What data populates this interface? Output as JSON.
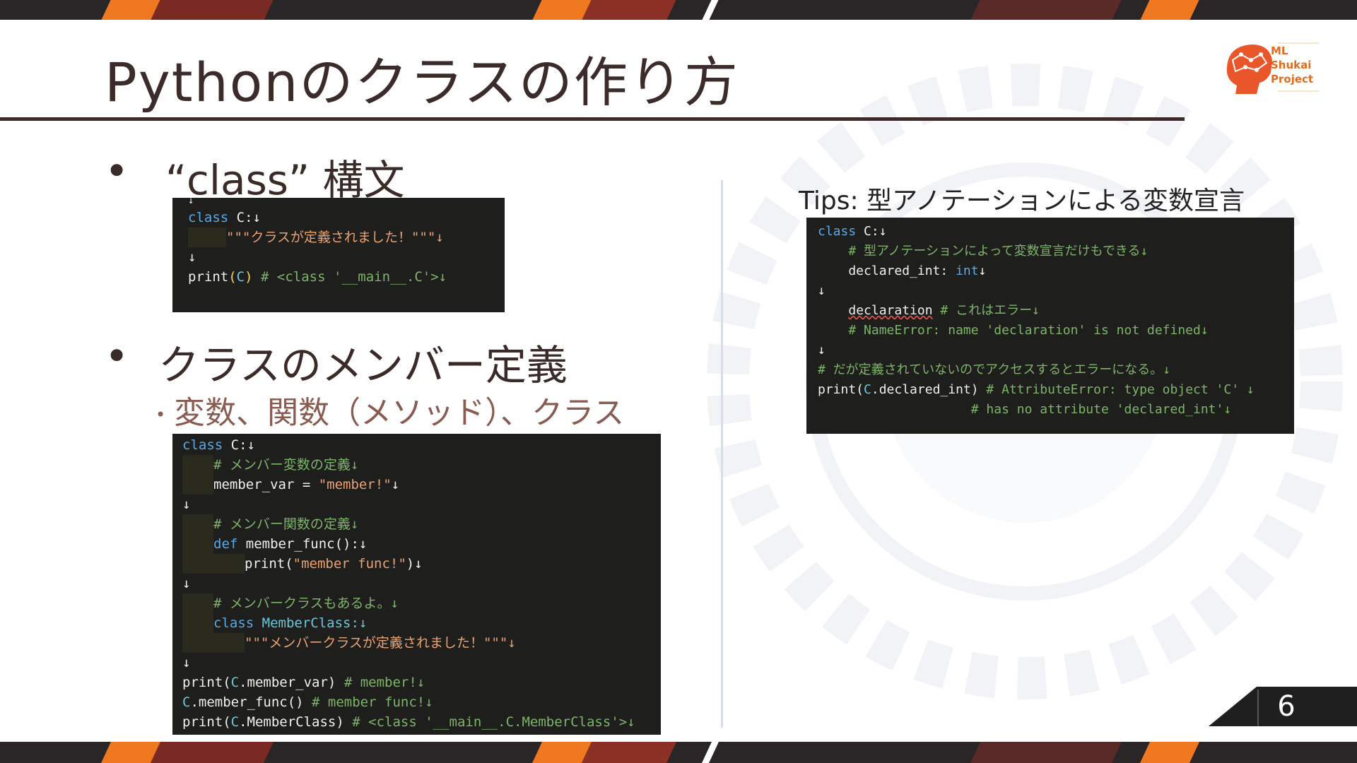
{
  "slide": {
    "title": "Pythonのクラスの作り方",
    "page_number": "6"
  },
  "logo": {
    "line1": "ML",
    "line2": "Shukai",
    "line3": "Project"
  },
  "bullets": {
    "b1": "“class” 構文",
    "b2": "クラスのメンバー定義",
    "b2_sub": "変数、関数（メソッド）、クラス",
    "dot": "•"
  },
  "code1": {
    "l0": "↓",
    "l1_kw": "class",
    "l1_rest": " C:↓",
    "l2": "\"\"\"クラスが定義されました！\"\"\"↓",
    "l3": "↓",
    "l4_fn": "print",
    "l4_arg": "C",
    "l4_cm": " # <class '__main__.C'>↓"
  },
  "code2": {
    "l1_kw": "class",
    "l1_rest": " C:↓",
    "l2": "# メンバー変数の定義↓",
    "l3_a": "member_var = ",
    "l3_b": "\"member!\"",
    "l3_c": "↓",
    "l4": "↓",
    "l5": "# メンバー関数の定義↓",
    "l6_kw": "def",
    "l6_rest": " member_func():↓",
    "l7_fn": "print(",
    "l7_str": "\"member func!\"",
    "l7_end": ")↓",
    "l8": "↓",
    "l9": "# メンバークラスもあるよ。↓",
    "l10_kw": "class",
    "l10_rest": " MemberClass:↓",
    "l11": "\"\"\"メンバークラスが定義されました！\"\"\"↓",
    "l12": "↓",
    "l13_a": "print(",
    "l13_b": "C",
    "l13_c": ".member_var)",
    "l13_cm": " # member!↓",
    "l14_a": "C",
    "l14_b": ".member_func()",
    "l14_cm": " # member func!↓",
    "l15_a": "print(",
    "l15_b": "C",
    "l15_c": ".MemberClass)",
    "l15_cm": " # <class '__main__.C.MemberClass'>↓"
  },
  "tips": {
    "title": "Tips: 型アノテーションによる変数宣言"
  },
  "code3": {
    "l1_kw": "class",
    "l1_rest": " C:↓",
    "l2": "    # 型アノテーションによって変数宣言だけもできる↓",
    "l3_a": "    declared_int: ",
    "l3_b": "int",
    "l3_c": "↓",
    "l4": "↓",
    "l5_a": "declaration",
    "l5_cm": " # これはエラー↓",
    "l6": "    # NameError: name 'declaration' is not defined↓",
    "l7": "↓",
    "l8": "# だが定義されていないのでアクセスするとエラーになる。↓",
    "l9_a": "print(",
    "l9_b": "C",
    "l9_c": ".declared_int)",
    "l9_cm": " # AttributeError: type object 'C' ↓",
    "l10": "                    # has no attribute 'declared_int'↓"
  },
  "colors": {
    "accent": "#f07820",
    "title_rule": "#3d2b2b",
    "code_bg": "#1e1f1c"
  }
}
